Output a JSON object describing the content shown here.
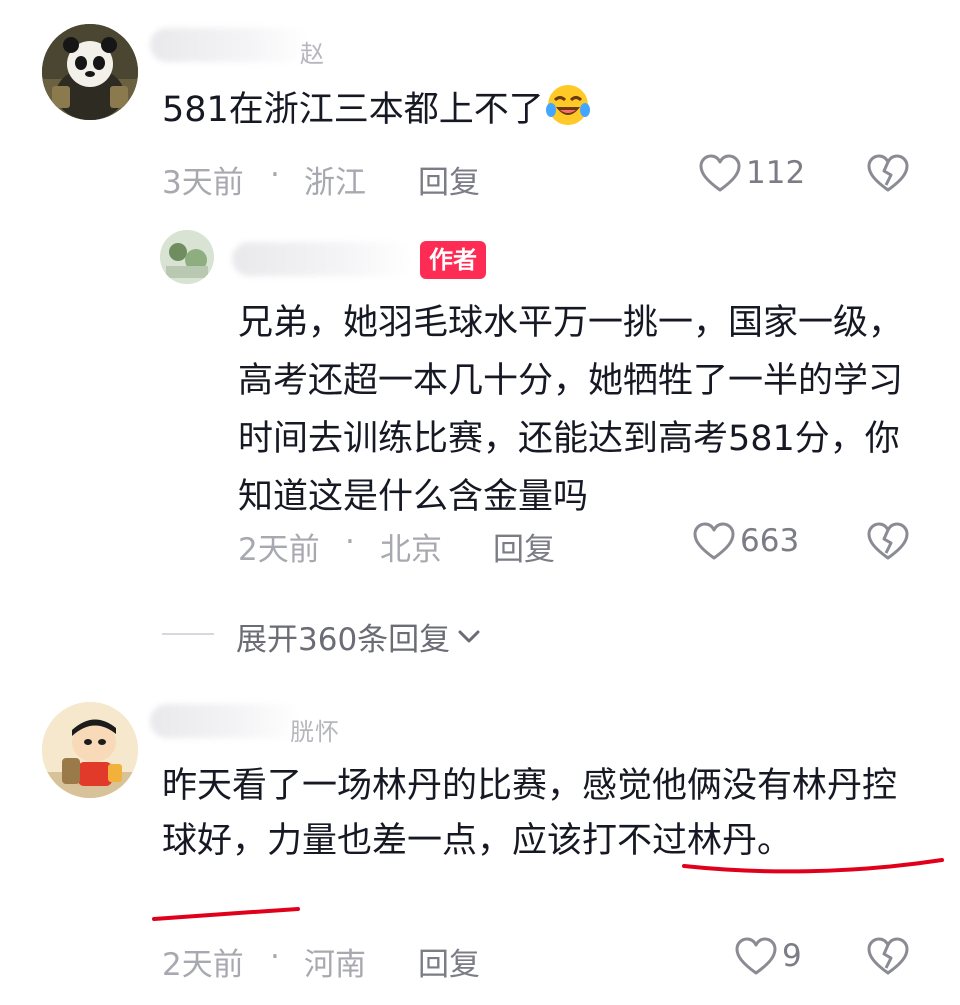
{
  "comments": [
    {
      "name_tail": "赵",
      "text": "581在浙江三本都上不了",
      "emoji": "laughing-tears-emoji",
      "time": "3天前",
      "separator": "·",
      "location": "浙江",
      "reply_label": "回复",
      "likes": "112"
    },
    {
      "author_badge": "作者",
      "text": "兄弟，她羽毛球水平万一挑一，国家一级，高考还超一本几十分，她牺牲了一半的学习时间去训练比赛，还能达到高考581分，你知道这是什么含金量吗",
      "time": "2天前",
      "separator": "·",
      "location": "北京",
      "reply_label": "回复",
      "likes": "663"
    },
    {
      "name_tail": "胱怀",
      "text": "昨天看了一场林丹的比赛，感觉他俩没有林丹控球好，力量也差一点，应该打不过林丹。",
      "time": "2天前",
      "separator": "·",
      "location": "河南",
      "reply_label": "回复",
      "likes": "9"
    }
  ],
  "expand_replies": {
    "label": "展开360条回复"
  },
  "colors": {
    "text": "#161823",
    "meta": "#a8a9b0",
    "badge": "#fe2c55",
    "annotation_red": "#e0001b"
  },
  "icons": [
    "heart-outline-icon",
    "broken-heart-icon",
    "chevron-down-icon"
  ]
}
